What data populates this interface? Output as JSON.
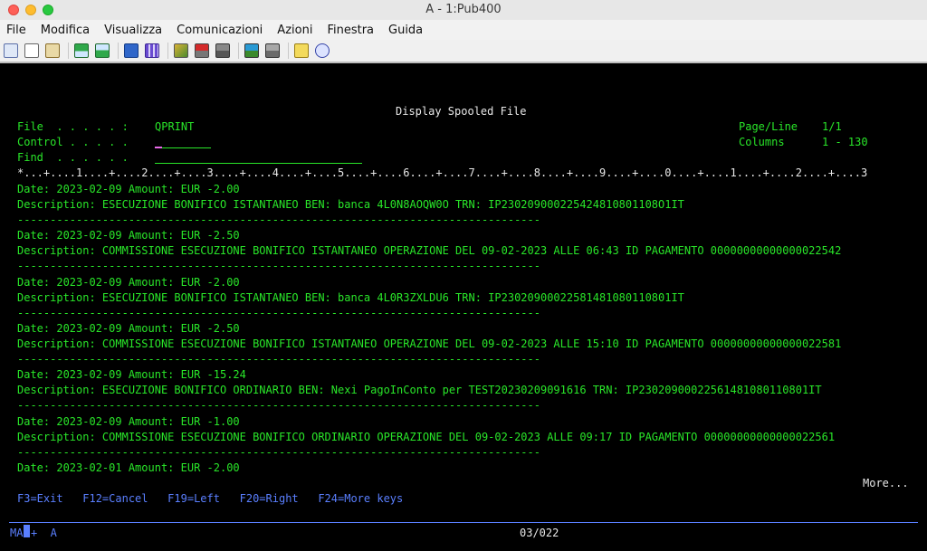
{
  "window": {
    "title": "A - 1:Pub400"
  },
  "menu": [
    "File",
    "Modifica",
    "Visualizza",
    "Comunicazioni",
    "Azioni",
    "Finestra",
    "Guida"
  ],
  "toolbar": {
    "icons": [
      "copy-icon",
      "paste-icon",
      "clipboard-icon",
      "send-file-icon",
      "receive-file-icon",
      "display-icon",
      "keypad-icon",
      "macro-record-icon",
      "macro-stop-icon",
      "macro-play-icon",
      "macro-pause-icon",
      "notes-icon",
      "help-icon"
    ]
  },
  "screen": {
    "header_title": "Display Spooled File",
    "file_label": "File  . . . . . :",
    "file_value": "QPRINT",
    "control_label": "Control . . . . .",
    "find_label": "Find  . . . . . .",
    "pageline_label": "Page/Line",
    "pageline_value": "1/1",
    "columns_label": "Columns",
    "columns_value": "1 - 130",
    "ruler": "*...+....1....+....2....+....3....+....4....+....5....+....6....+....7....+....8....+....9....+....0....+....1....+....2....+....3",
    "lines": [
      "Date: 2023-02-09 Amount: EUR -2.00",
      "Description: ESECUZIONE BONIFICO ISTANTANEO BEN: banca 4L0N8AOQW0O TRN: IP230209000225424810801108O1IT",
      "--------------------------------------------------------------------------------",
      "Date: 2023-02-09 Amount: EUR -2.50",
      "Description: COMMISSIONE ESECUZIONE BONIFICO ISTANTANEO OPERAZIONE DEL 09-02-2023 ALLE 06:43 ID PAGAMENTO 00000000000000022542",
      "--------------------------------------------------------------------------------",
      "Date: 2023-02-09 Amount: EUR -2.00",
      "Description: ESECUZIONE BONIFICO ISTANTANEO BEN: banca 4L0R3ZXLDU6 TRN: IP23020900022581481080110801IT",
      "--------------------------------------------------------------------------------",
      "Date: 2023-02-09 Amount: EUR -2.50",
      "Description: COMMISSIONE ESECUZIONE BONIFICO ISTANTANEO OPERAZIONE DEL 09-02-2023 ALLE 15:10 ID PAGAMENTO 00000000000000022581",
      "--------------------------------------------------------------------------------",
      "Date: 2023-02-09 Amount: EUR -15.24",
      "Description: ESECUZIONE BONIFICO ORDINARIO BEN: Nexi PagoInConto per TEST20230209091616 TRN: IP23020900022561481080110801IT",
      "--------------------------------------------------------------------------------",
      "Date: 2023-02-09 Amount: EUR -1.00",
      "Description: COMMISSIONE ESECUZIONE BONIFICO ORDINARIO OPERAZIONE DEL 09-02-2023 ALLE 09:17 ID PAGAMENTO 00000000000000022561",
      "--------------------------------------------------------------------------------",
      "Date: 2023-02-01 Amount: EUR -2.00"
    ],
    "more": "More...",
    "fkeys": "F3=Exit   F12=Cancel   F19=Left   F20=Right   F24=More keys",
    "status_left_a": "MA",
    "status_left_b": "+  A",
    "status_pos": "03/022"
  }
}
